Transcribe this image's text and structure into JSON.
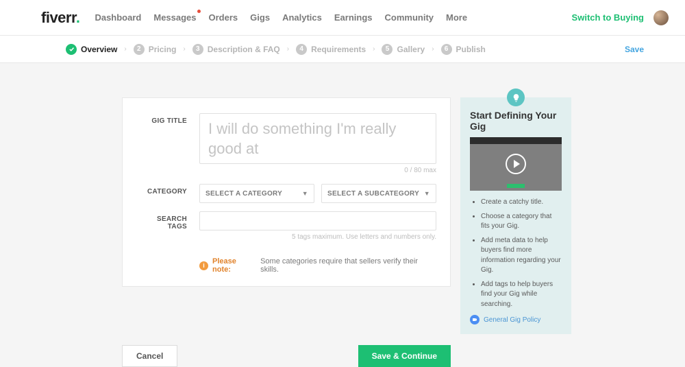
{
  "logo": "fiverr",
  "nav": {
    "dashboard": "Dashboard",
    "messages": "Messages",
    "orders": "Orders",
    "gigs": "Gigs",
    "analytics": "Analytics",
    "earnings": "Earnings",
    "community": "Community",
    "more": "More"
  },
  "switch": "Switch to Buying",
  "steps": {
    "s1": "Overview",
    "s2": "Pricing",
    "s3": "Description & FAQ",
    "s4": "Requirements",
    "s5": "Gallery",
    "s6": "Publish",
    "n2": "2",
    "n3": "3",
    "n4": "4",
    "n5": "5",
    "n6": "6"
  },
  "save": "Save",
  "form": {
    "title_label": "GIG TITLE",
    "title_placeholder": "I will do something I'm really good at",
    "title_counter": "0 / 80 max",
    "category_label": "CATEGORY",
    "select_category": "SELECT A CATEGORY",
    "select_subcategory": "SELECT A SUBCATEGORY",
    "tags_label": "SEARCH TAGS",
    "tags_hint": "5 tags maximum. Use letters and numbers only.",
    "note_label": "Please note:",
    "note_text": "Some categories require that sellers verify their skills."
  },
  "tips": {
    "title": "Start Defining Your Gig",
    "i0": "Create a catchy title.",
    "i1": "Choose a category that fits your Gig.",
    "i2": "Add meta data to help buyers find more information regarding your Gig.",
    "i3": "Add tags to help buyers find your Gig while searching.",
    "policy": "General Gig Policy"
  },
  "actions": {
    "cancel": "Cancel",
    "continue": "Save & Continue"
  }
}
